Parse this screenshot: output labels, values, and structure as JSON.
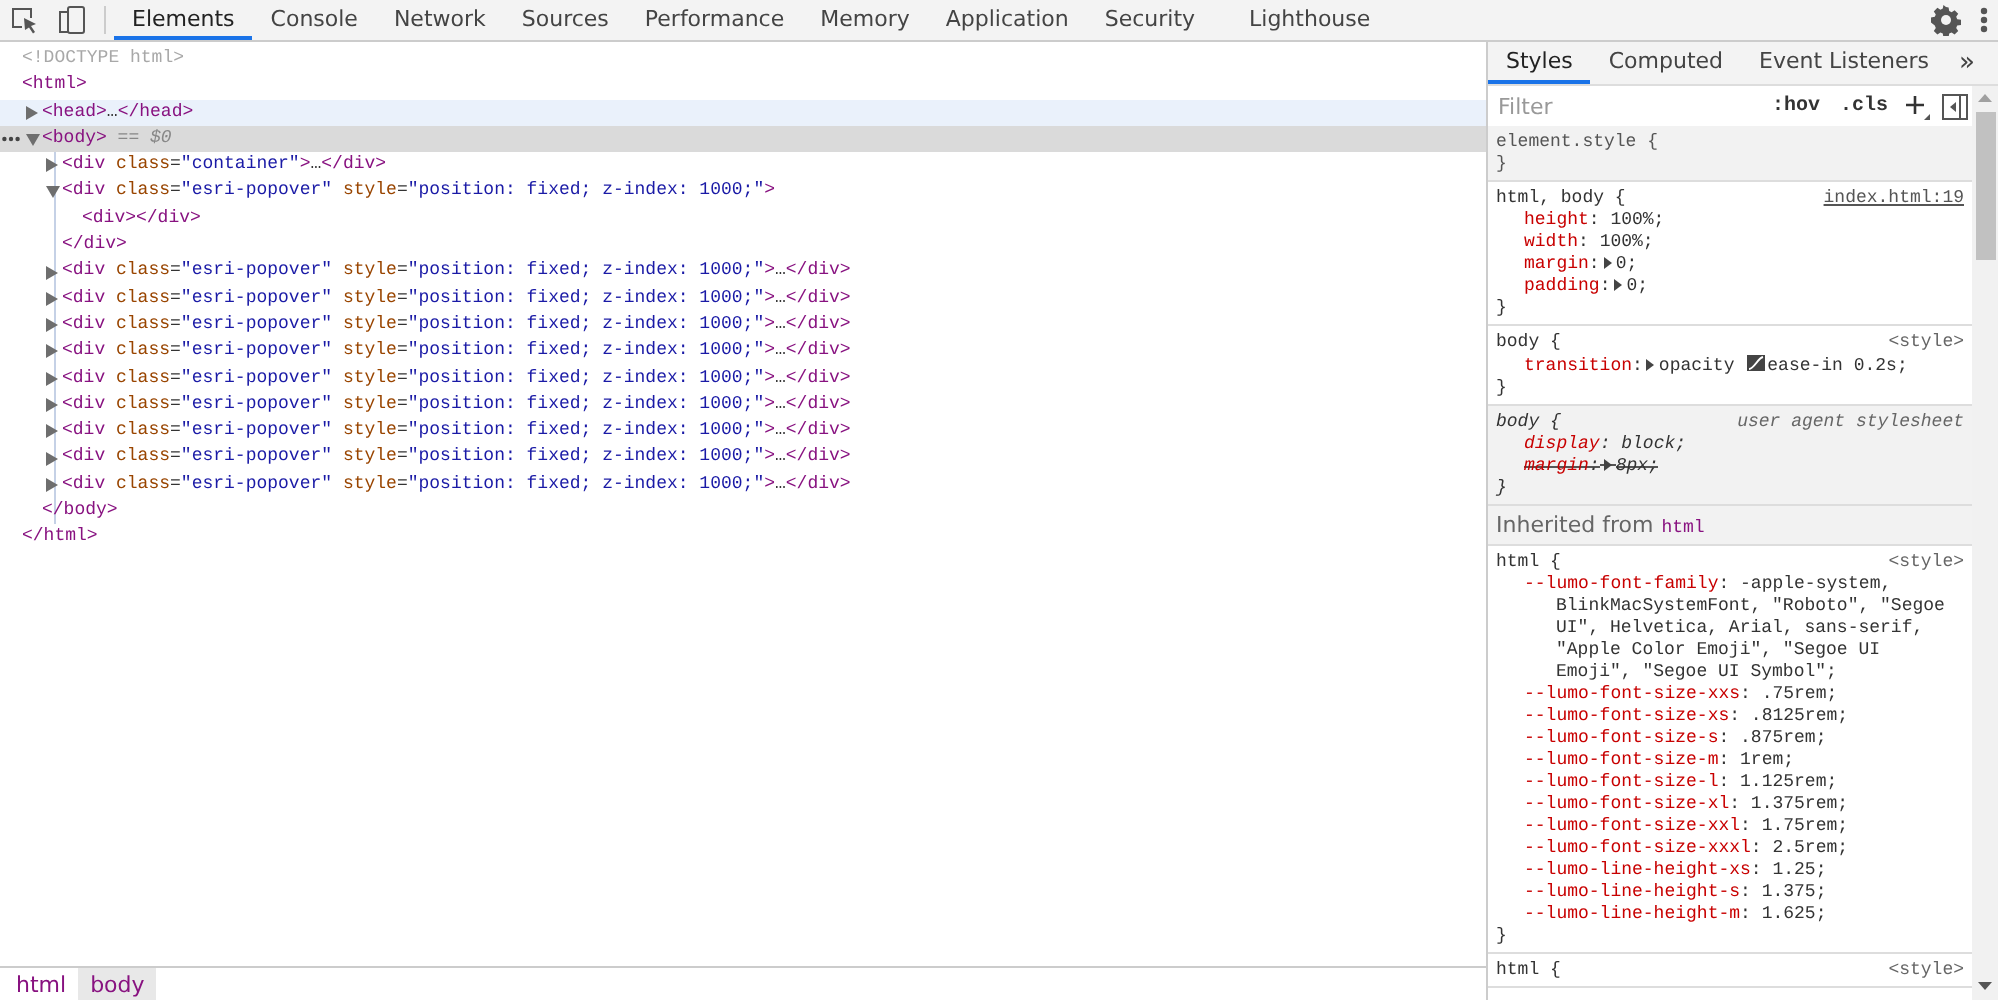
{
  "toolbar": {
    "tabs": [
      {
        "label": "Elements",
        "selected": true
      },
      {
        "label": "Console",
        "selected": false
      },
      {
        "label": "Network",
        "selected": false
      },
      {
        "label": "Sources",
        "selected": false
      },
      {
        "label": "Performance",
        "selected": false
      },
      {
        "label": "Memory",
        "selected": false
      },
      {
        "label": "Application",
        "selected": false
      },
      {
        "label": "Security",
        "selected": false
      },
      {
        "label": "Lighthouse",
        "selected": false
      }
    ]
  },
  "dom": [
    {
      "tokens": [
        {
          "kind": "comment",
          "text": "<!DOCTYPE html>"
        }
      ],
      "selected": false,
      "hovered": false
    },
    {
      "tokens": [
        {
          "kind": "tag",
          "text": "<html>"
        }
      ],
      "selected": false,
      "hovered": false,
      "close": [
        {
          "kind": "tag",
          "text": "</html>"
        }
      ],
      "children": [
        {
          "tokens": [
            {
              "kind": "tag",
              "text": "<head>"
            },
            {
              "kind": "punct",
              "text": "…"
            },
            {
              "kind": "tag",
              "text": "</head>"
            }
          ],
          "expanded": false,
          "selected": false,
          "hovered": true
        },
        {
          "tokens": [
            {
              "kind": "tag",
              "text": "<body>"
            },
            {
              "kind": "dim",
              "text": " == $0"
            }
          ],
          "expanded": true,
          "selected": true,
          "hovered": false,
          "close": [
            {
              "kind": "tag",
              "text": "</body>"
            }
          ],
          "children": [
            {
              "tokens": [
                {
                  "kind": "tag",
                  "text": "<div"
                },
                {
                  "kind": "attr",
                  "text": " class"
                },
                {
                  "kind": "punct",
                  "text": "="
                },
                {
                  "kind": "value",
                  "text": "\"container\""
                },
                {
                  "kind": "tag",
                  "text": ">"
                },
                {
                  "kind": "punct",
                  "text": "…"
                },
                {
                  "kind": "tag",
                  "text": "</div>"
                }
              ],
              "expanded": false,
              "selected": false,
              "hovered": false
            },
            {
              "tokens": [
                {
                  "kind": "tag",
                  "text": "<div"
                },
                {
                  "kind": "attr",
                  "text": " class"
                },
                {
                  "kind": "punct",
                  "text": "="
                },
                {
                  "kind": "value",
                  "text": "\"esri-popover\""
                },
                {
                  "kind": "attr",
                  "text": " style"
                },
                {
                  "kind": "punct",
                  "text": "="
                },
                {
                  "kind": "value",
                  "text": "\"position: fixed; z-index: 1000;\""
                },
                {
                  "kind": "tag",
                  "text": ">"
                }
              ],
              "expanded": true,
              "selected": false,
              "hovered": false,
              "close": [
                {
                  "kind": "tag",
                  "text": "</div>"
                }
              ],
              "children": [
                {
                  "tokens": [
                    {
                      "kind": "tag",
                      "text": "<div></div>"
                    }
                  ],
                  "selected": false,
                  "hovered": false
                }
              ]
            },
            {
              "tokens": [
                {
                  "kind": "tag",
                  "text": "<div"
                },
                {
                  "kind": "attr",
                  "text": " class"
                },
                {
                  "kind": "punct",
                  "text": "="
                },
                {
                  "kind": "value",
                  "text": "\"esri-popover\""
                },
                {
                  "kind": "attr",
                  "text": " style"
                },
                {
                  "kind": "punct",
                  "text": "="
                },
                {
                  "kind": "value",
                  "text": "\"position: fixed; z-index: 1000;\""
                },
                {
                  "kind": "tag",
                  "text": ">"
                },
                {
                  "kind": "punct",
                  "text": "…"
                },
                {
                  "kind": "tag",
                  "text": "</div>"
                }
              ],
              "expanded": false,
              "selected": false,
              "hovered": false
            },
            {
              "tokens": [
                {
                  "kind": "tag",
                  "text": "<div"
                },
                {
                  "kind": "attr",
                  "text": " class"
                },
                {
                  "kind": "punct",
                  "text": "="
                },
                {
                  "kind": "value",
                  "text": "\"esri-popover\""
                },
                {
                  "kind": "attr",
                  "text": " style"
                },
                {
                  "kind": "punct",
                  "text": "="
                },
                {
                  "kind": "value",
                  "text": "\"position: fixed; z-index: 1000;\""
                },
                {
                  "kind": "tag",
                  "text": ">"
                },
                {
                  "kind": "punct",
                  "text": "…"
                },
                {
                  "kind": "tag",
                  "text": "</div>"
                }
              ],
              "expanded": false,
              "selected": false,
              "hovered": false
            },
            {
              "tokens": [
                {
                  "kind": "tag",
                  "text": "<div"
                },
                {
                  "kind": "attr",
                  "text": " class"
                },
                {
                  "kind": "punct",
                  "text": "="
                },
                {
                  "kind": "value",
                  "text": "\"esri-popover\""
                },
                {
                  "kind": "attr",
                  "text": " style"
                },
                {
                  "kind": "punct",
                  "text": "="
                },
                {
                  "kind": "value",
                  "text": "\"position: fixed; z-index: 1000;\""
                },
                {
                  "kind": "tag",
                  "text": ">"
                },
                {
                  "kind": "punct",
                  "text": "…"
                },
                {
                  "kind": "tag",
                  "text": "</div>"
                }
              ],
              "expanded": false,
              "selected": false,
              "hovered": false
            },
            {
              "tokens": [
                {
                  "kind": "tag",
                  "text": "<div"
                },
                {
                  "kind": "attr",
                  "text": " class"
                },
                {
                  "kind": "punct",
                  "text": "="
                },
                {
                  "kind": "value",
                  "text": "\"esri-popover\""
                },
                {
                  "kind": "attr",
                  "text": " style"
                },
                {
                  "kind": "punct",
                  "text": "="
                },
                {
                  "kind": "value",
                  "text": "\"position: fixed; z-index: 1000;\""
                },
                {
                  "kind": "tag",
                  "text": ">"
                },
                {
                  "kind": "punct",
                  "text": "…"
                },
                {
                  "kind": "tag",
                  "text": "</div>"
                }
              ],
              "expanded": false,
              "selected": false,
              "hovered": false
            },
            {
              "tokens": [
                {
                  "kind": "tag",
                  "text": "<div"
                },
                {
                  "kind": "attr",
                  "text": " class"
                },
                {
                  "kind": "punct",
                  "text": "="
                },
                {
                  "kind": "value",
                  "text": "\"esri-popover\""
                },
                {
                  "kind": "attr",
                  "text": " style"
                },
                {
                  "kind": "punct",
                  "text": "="
                },
                {
                  "kind": "value",
                  "text": "\"position: fixed; z-index: 1000;\""
                },
                {
                  "kind": "tag",
                  "text": ">"
                },
                {
                  "kind": "punct",
                  "text": "…"
                },
                {
                  "kind": "tag",
                  "text": "</div>"
                }
              ],
              "expanded": false,
              "selected": false,
              "hovered": false
            },
            {
              "tokens": [
                {
                  "kind": "tag",
                  "text": "<div"
                },
                {
                  "kind": "attr",
                  "text": " class"
                },
                {
                  "kind": "punct",
                  "text": "="
                },
                {
                  "kind": "value",
                  "text": "\"esri-popover\""
                },
                {
                  "kind": "attr",
                  "text": " style"
                },
                {
                  "kind": "punct",
                  "text": "="
                },
                {
                  "kind": "value",
                  "text": "\"position: fixed; z-index: 1000;\""
                },
                {
                  "kind": "tag",
                  "text": ">"
                },
                {
                  "kind": "punct",
                  "text": "…"
                },
                {
                  "kind": "tag",
                  "text": "</div>"
                }
              ],
              "expanded": false,
              "selected": false,
              "hovered": false
            },
            {
              "tokens": [
                {
                  "kind": "tag",
                  "text": "<div"
                },
                {
                  "kind": "attr",
                  "text": " class"
                },
                {
                  "kind": "punct",
                  "text": "="
                },
                {
                  "kind": "value",
                  "text": "\"esri-popover\""
                },
                {
                  "kind": "attr",
                  "text": " style"
                },
                {
                  "kind": "punct",
                  "text": "="
                },
                {
                  "kind": "value",
                  "text": "\"position: fixed; z-index: 1000;\""
                },
                {
                  "kind": "tag",
                  "text": ">"
                },
                {
                  "kind": "punct",
                  "text": "…"
                },
                {
                  "kind": "tag",
                  "text": "</div>"
                }
              ],
              "expanded": false,
              "selected": false,
              "hovered": false
            },
            {
              "tokens": [
                {
                  "kind": "tag",
                  "text": "<div"
                },
                {
                  "kind": "attr",
                  "text": " class"
                },
                {
                  "kind": "punct",
                  "text": "="
                },
                {
                  "kind": "value",
                  "text": "\"esri-popover\""
                },
                {
                  "kind": "attr",
                  "text": " style"
                },
                {
                  "kind": "punct",
                  "text": "="
                },
                {
                  "kind": "value",
                  "text": "\"position: fixed; z-index: 1000;\""
                },
                {
                  "kind": "tag",
                  "text": ">"
                },
                {
                  "kind": "punct",
                  "text": "…"
                },
                {
                  "kind": "tag",
                  "text": "</div>"
                }
              ],
              "expanded": false,
              "selected": false,
              "hovered": false
            },
            {
              "tokens": [
                {
                  "kind": "tag",
                  "text": "<div"
                },
                {
                  "kind": "attr",
                  "text": " class"
                },
                {
                  "kind": "punct",
                  "text": "="
                },
                {
                  "kind": "value",
                  "text": "\"esri-popover\""
                },
                {
                  "kind": "attr",
                  "text": " style"
                },
                {
                  "kind": "punct",
                  "text": "="
                },
                {
                  "kind": "value",
                  "text": "\"position: fixed; z-index: 1000;\""
                },
                {
                  "kind": "tag",
                  "text": ">"
                },
                {
                  "kind": "punct",
                  "text": "…"
                },
                {
                  "kind": "tag",
                  "text": "</div>"
                }
              ],
              "expanded": false,
              "selected": false,
              "hovered": false
            }
          ]
        }
      ]
    }
  ],
  "breadcrumbs": [
    {
      "label": "html",
      "selected": false
    },
    {
      "label": "body",
      "selected": true
    }
  ],
  "styles": {
    "tabs": [
      {
        "label": "Styles",
        "selected": true
      },
      {
        "label": "Computed",
        "selected": false
      },
      {
        "label": "Event Listeners",
        "selected": false
      }
    ],
    "more_tabs": "»",
    "filter": {
      "placeholder": "Filter"
    },
    "buttons": [
      ":hov",
      ".cls"
    ],
    "sections": [
      {
        "kind": "rule",
        "selector": "element.style {",
        "close": "}"
      },
      {
        "kind": "rule",
        "selector": "html, body {",
        "source": "index.html:19",
        "source_link": true,
        "close": "}",
        "properties": [
          {
            "overridden": false,
            "tokens": [
              {
                "kind": "name",
                "text": "height"
              },
              {
                "kind": "plain",
                "text": ": 100%;"
              }
            ]
          },
          {
            "overridden": false,
            "tokens": [
              {
                "kind": "name",
                "text": "width"
              },
              {
                "kind": "plain",
                "text": ": 100%;"
              }
            ]
          },
          {
            "overridden": false,
            "tokens": [
              {
                "kind": "name",
                "text": "margin"
              },
              {
                "kind": "plain",
                "text": ":"
              },
              {
                "kind": "expander"
              },
              {
                "kind": "plain",
                "text": "0;"
              }
            ]
          },
          {
            "overridden": false,
            "tokens": [
              {
                "kind": "name",
                "text": "padding"
              },
              {
                "kind": "plain",
                "text": ":"
              },
              {
                "kind": "expander"
              },
              {
                "kind": "plain",
                "text": "0;"
              }
            ]
          }
        ]
      },
      {
        "kind": "rule",
        "selector": "body {",
        "source": "<style>",
        "source_link": false,
        "close": "}",
        "properties": [
          {
            "overridden": false,
            "tokens": [
              {
                "kind": "name",
                "text": "transition"
              },
              {
                "kind": "plain",
                "text": ":"
              },
              {
                "kind": "expander"
              },
              {
                "kind": "plain",
                "text": "opacity "
              },
              {
                "kind": "swatch"
              },
              {
                "kind": "plain",
                "text": "ease-in 0.2s;"
              }
            ]
          }
        ]
      },
      {
        "kind": "ua-rule",
        "selector": "body {",
        "source": "user agent stylesheet",
        "source_link": false,
        "close": "}",
        "properties": [
          {
            "overridden": false,
            "tokens": [
              {
                "kind": "name",
                "text": "display"
              },
              {
                "kind": "plain",
                "text": ": block;"
              }
            ]
          },
          {
            "overridden": true,
            "tokens": [
              {
                "kind": "name",
                "text": "margin"
              },
              {
                "kind": "plain",
                "text": ":"
              },
              {
                "kind": "expander"
              },
              {
                "kind": "plain",
                "text": "8px;"
              }
            ]
          }
        ]
      },
      {
        "kind": "inherited",
        "label": "Inherited from",
        "element": "html"
      },
      {
        "kind": "rule",
        "selector": "html {",
        "source": "<style>",
        "source_link": false,
        "close": "}",
        "properties": [
          {
            "overridden": false,
            "tokens": [
              {
                "kind": "name",
                "text": "--lumo-font-family"
              },
              {
                "kind": "plain",
                "text": ": -apple-system, BlinkMacSystemFont, \"Roboto\", \"Segoe UI\", Helvetica, Arial, sans-serif, \"Apple Color Emoji\", \"Segoe UI Emoji\", \"Segoe UI Symbol\";"
              }
            ]
          },
          {
            "overridden": false,
            "tokens": [
              {
                "kind": "name",
                "text": "--lumo-font-size-xxs"
              },
              {
                "kind": "plain",
                "text": ": .75rem;"
              }
            ]
          },
          {
            "overridden": false,
            "tokens": [
              {
                "kind": "name",
                "text": "--lumo-font-size-xs"
              },
              {
                "kind": "plain",
                "text": ": .8125rem;"
              }
            ]
          },
          {
            "overridden": false,
            "tokens": [
              {
                "kind": "name",
                "text": "--lumo-font-size-s"
              },
              {
                "kind": "plain",
                "text": ": .875rem;"
              }
            ]
          },
          {
            "overridden": false,
            "tokens": [
              {
                "kind": "name",
                "text": "--lumo-font-size-m"
              },
              {
                "kind": "plain",
                "text": ": 1rem;"
              }
            ]
          },
          {
            "overridden": false,
            "tokens": [
              {
                "kind": "name",
                "text": "--lumo-font-size-l"
              },
              {
                "kind": "plain",
                "text": ": 1.125rem;"
              }
            ]
          },
          {
            "overridden": false,
            "tokens": [
              {
                "kind": "name",
                "text": "--lumo-font-size-xl"
              },
              {
                "kind": "plain",
                "text": ": 1.375rem;"
              }
            ]
          },
          {
            "overridden": false,
            "tokens": [
              {
                "kind": "name",
                "text": "--lumo-font-size-xxl"
              },
              {
                "kind": "plain",
                "text": ": 1.75rem;"
              }
            ]
          },
          {
            "overridden": false,
            "tokens": [
              {
                "kind": "name",
                "text": "--lumo-font-size-xxxl"
              },
              {
                "kind": "plain",
                "text": ": 2.5rem;"
              }
            ]
          },
          {
            "overridden": false,
            "tokens": [
              {
                "kind": "name",
                "text": "--lumo-line-height-xs"
              },
              {
                "kind": "plain",
                "text": ": 1.25;"
              }
            ]
          },
          {
            "overridden": false,
            "tokens": [
              {
                "kind": "name",
                "text": "--lumo-line-height-s"
              },
              {
                "kind": "plain",
                "text": ": 1.375;"
              }
            ]
          },
          {
            "overridden": false,
            "tokens": [
              {
                "kind": "name",
                "text": "--lumo-line-height-m"
              },
              {
                "kind": "plain",
                "text": ": 1.625;"
              }
            ]
          }
        ]
      },
      {
        "kind": "rule",
        "selector": "html {",
        "source": "<style>",
        "source_link": false
      }
    ]
  }
}
